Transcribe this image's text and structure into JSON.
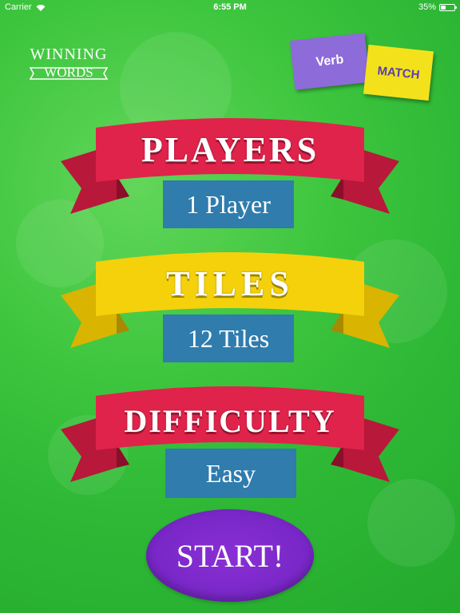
{
  "status_bar": {
    "carrier": "Carrier",
    "time": "6:55 PM",
    "battery_percent": "35%",
    "battery_level": 0.35
  },
  "logo": {
    "line1": "WINNING",
    "line2": "WORDS"
  },
  "game_mode": {
    "verb_label": "Verb",
    "match_label": "MATCH"
  },
  "settings": {
    "players": {
      "title": "PLAYERS",
      "value": "1 Player",
      "ribbon_color": "#e0234a"
    },
    "tiles": {
      "title": "TILES",
      "value": "12 Tiles",
      "ribbon_color": "#f5d10c"
    },
    "difficulty": {
      "title": "DIFFICULTY",
      "value": "Easy",
      "ribbon_color": "#e0234a"
    }
  },
  "start_label": "START!",
  "colors": {
    "background": "#3fc63f",
    "value_box": "#2f7cad",
    "start_button": "#7a28c8",
    "verb_tile": "#8d6bd9",
    "match_tile": "#f3e21b"
  }
}
